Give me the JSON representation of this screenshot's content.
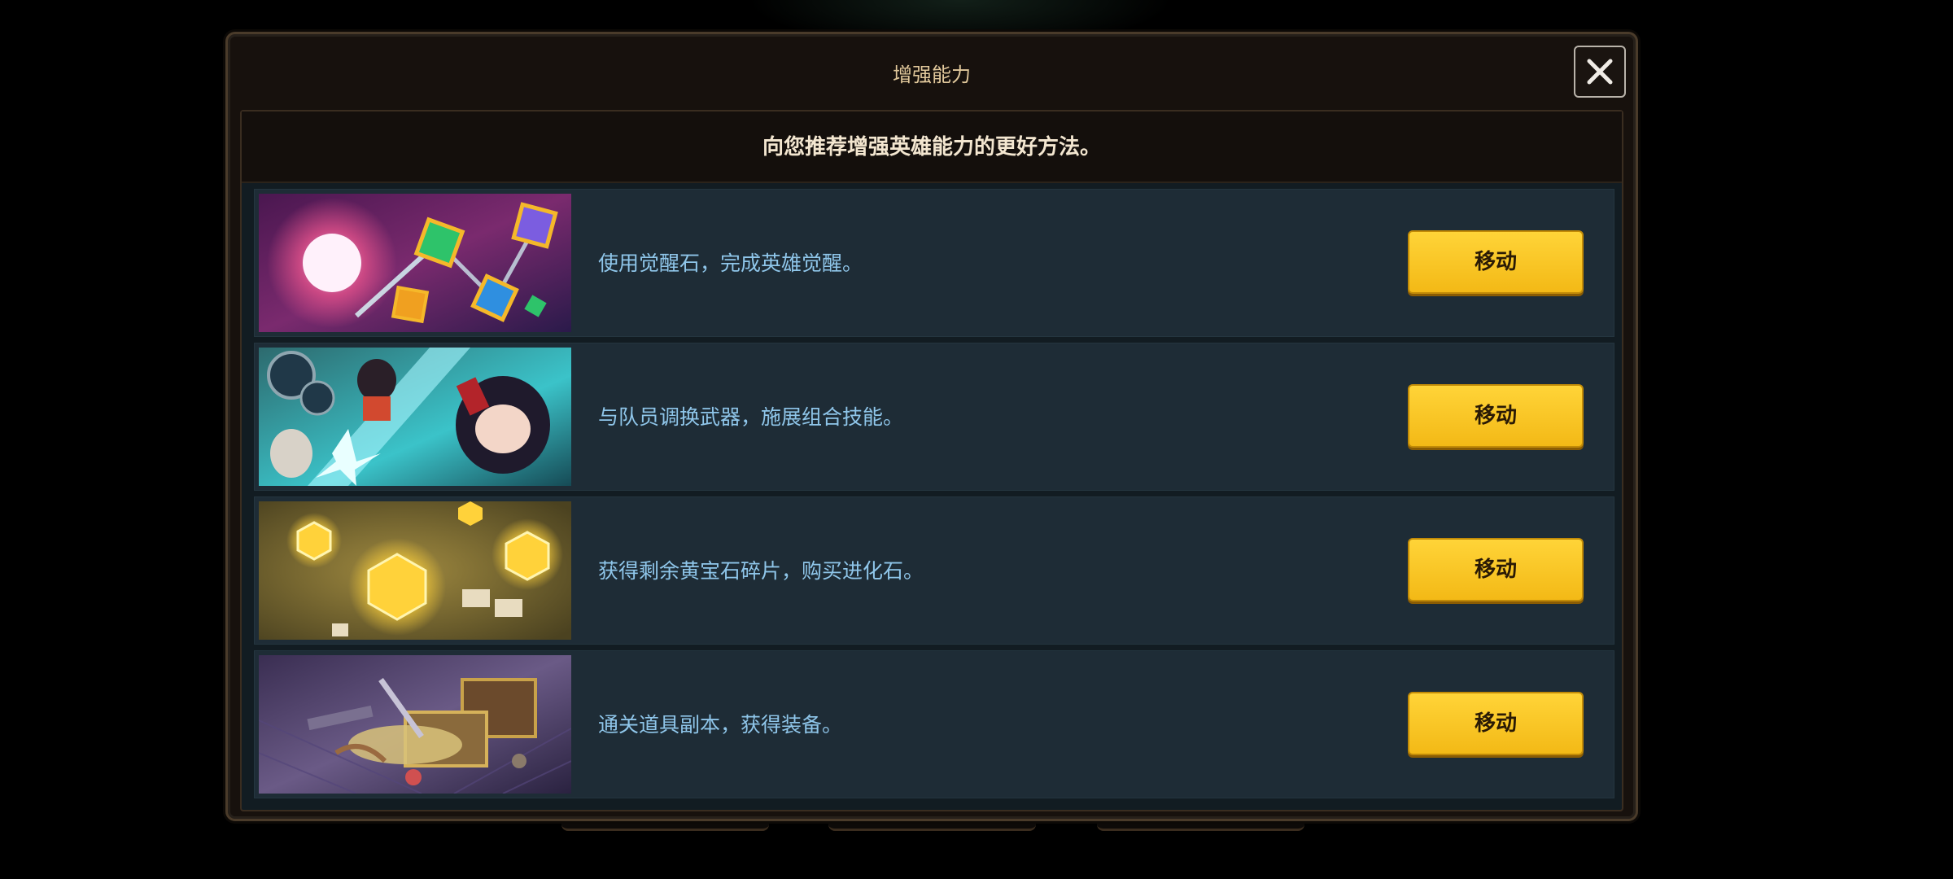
{
  "dialog": {
    "title": "增强能力",
    "subtitle": "向您推荐增强英雄能力的更好方法。",
    "close_icon": "close-icon"
  },
  "colors": {
    "accent_button": "#ffd438",
    "row_text": "#8fc6ea",
    "row_background": "#1e2c36"
  },
  "items": [
    {
      "text": "使用觉醒石，完成英雄觉醒。",
      "button": "移动",
      "image": "awakening-stones-art"
    },
    {
      "text": "与队员调换武器，施展组合技能。",
      "button": "移动",
      "image": "hero-weapon-swap-art"
    },
    {
      "text": "获得剩余黄宝石碎片，购买进化石。",
      "button": "移动",
      "image": "gold-gem-map-art"
    },
    {
      "text": "通关道具副本，获得装备。",
      "button": "移动",
      "image": "treasure-chest-art"
    }
  ]
}
